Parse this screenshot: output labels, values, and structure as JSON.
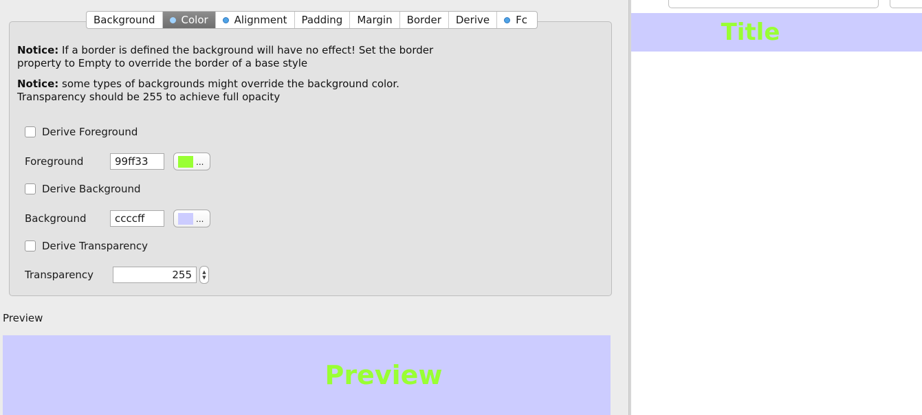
{
  "tabs": [
    {
      "label": "Background",
      "dot": false,
      "selected": false
    },
    {
      "label": "Color",
      "dot": true,
      "selected": true
    },
    {
      "label": "Alignment",
      "dot": true,
      "selected": false
    },
    {
      "label": "Padding",
      "dot": false,
      "selected": false
    },
    {
      "label": "Margin",
      "dot": false,
      "selected": false
    },
    {
      "label": "Border",
      "dot": false,
      "selected": false
    },
    {
      "label": "Derive",
      "dot": false,
      "selected": false
    },
    {
      "label": "Fc",
      "dot": true,
      "selected": false
    }
  ],
  "notices": [
    {
      "bold": "Notice:",
      "line1": " If a border is defined the background will have no effect! Set the border",
      "line2": "property to Empty to override the border of a base style"
    },
    {
      "bold": "Notice:",
      "line1": " some types of backgrounds might override the background color.",
      "line2": "Transparency should be 255 to achieve full opacity"
    }
  ],
  "derive_foreground": {
    "label": "Derive Foreground",
    "checked": false
  },
  "foreground": {
    "label": "Foreground",
    "value": "99ff33",
    "swatch_color": "#99ff33",
    "button_text": "..."
  },
  "derive_background": {
    "label": "Derive Background",
    "checked": false
  },
  "background": {
    "label": "Background",
    "value": "ccccff",
    "swatch_color": "#ccccff",
    "button_text": "..."
  },
  "derive_transparency": {
    "label": "Derive Transparency",
    "checked": false
  },
  "transparency": {
    "label": "Transparency",
    "value": "255"
  },
  "preview": {
    "label": "Preview",
    "text": "Preview",
    "bg_color": "#ccccff",
    "fg_color": "#99ff33"
  },
  "right_panel": {
    "title": "Title",
    "bg_color": "#ccccff",
    "fg_color": "#99ff33"
  }
}
